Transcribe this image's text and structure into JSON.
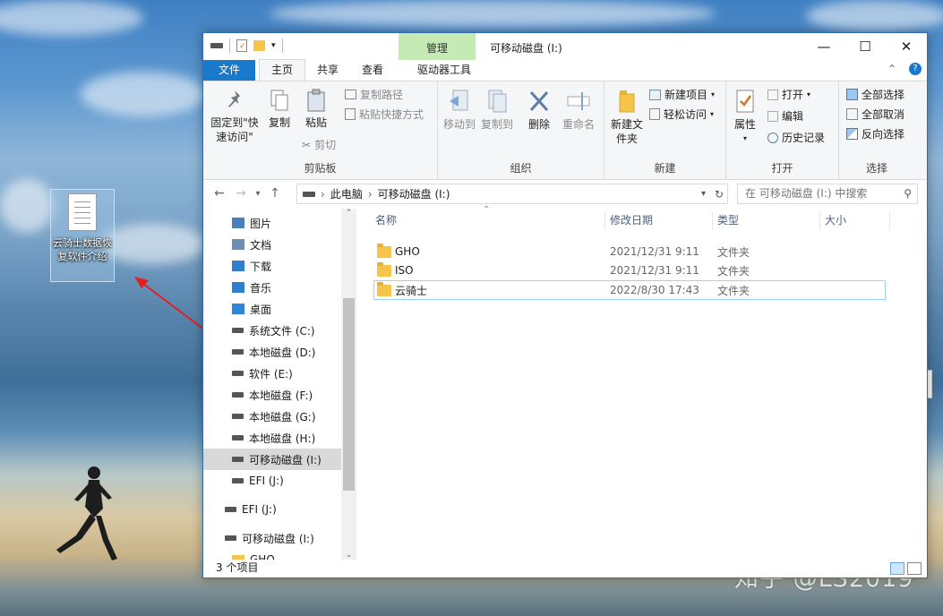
{
  "desktop": {
    "icon_label": "云骑士数据恢复软件介绍",
    "watermark": "知乎 @LS2019"
  },
  "window": {
    "title": "可移动磁盘 (I:)",
    "context_tab": "管理",
    "controls": {
      "minimize": "—",
      "maximize": "☐",
      "close": "✕"
    }
  },
  "tabs": {
    "file": "文件",
    "home": "主页",
    "share": "共享",
    "view": "查看",
    "drive_tools": "驱动器工具"
  },
  "ribbon": {
    "clipboard": {
      "pin": "固定到\"快速访问\"",
      "copy": "复制",
      "paste": "粘贴",
      "copy_path": "复制路径",
      "paste_shortcut": "粘贴快捷方式",
      "cut": "剪切",
      "group": "剪贴板"
    },
    "organize": {
      "move_to": "移动到",
      "copy_to": "复制到",
      "delete": "删除",
      "rename": "重命名",
      "group": "组织"
    },
    "new": {
      "new_folder": "新建文件夹",
      "new_item": "新建项目",
      "easy_access": "轻松访问",
      "group": "新建"
    },
    "open": {
      "properties": "属性",
      "open": "打开",
      "edit": "编辑",
      "history": "历史记录",
      "group": "打开"
    },
    "select": {
      "select_all": "全部选择",
      "select_none": "全部取消",
      "invert": "反向选择",
      "group": "选择"
    }
  },
  "address": {
    "crumbs": [
      "此电脑",
      "可移动磁盘 (I:)"
    ],
    "separator": "›",
    "search_placeholder": "在 可移动磁盘 (I:) 中搜索"
  },
  "nav": {
    "items": [
      {
        "label": "图片",
        "icon": "pictures-icon"
      },
      {
        "label": "文档",
        "icon": "documents-icon"
      },
      {
        "label": "下载",
        "icon": "download-icon"
      },
      {
        "label": "音乐",
        "icon": "music-icon"
      },
      {
        "label": "桌面",
        "icon": "desktop-icon"
      },
      {
        "label": "系统文件 (C:)",
        "icon": "system-drive-icon"
      },
      {
        "label": "本地磁盘 (D:)",
        "icon": "drive-icon"
      },
      {
        "label": "软件 (E:)",
        "icon": "drive-icon"
      },
      {
        "label": "本地磁盘 (F:)",
        "icon": "drive-icon"
      },
      {
        "label": "本地磁盘 (G:)",
        "icon": "drive-icon"
      },
      {
        "label": "本地磁盘 (H:)",
        "icon": "drive-icon"
      },
      {
        "label": "可移动磁盘 (I:)",
        "icon": "usb-drive-icon"
      },
      {
        "label": "EFI (J:)",
        "icon": "usb-drive-icon"
      },
      {
        "label": "EFI (J:)",
        "icon": "usb-drive-icon"
      },
      {
        "label": "可移动磁盘 (I:)",
        "icon": "usb-drive-icon"
      },
      {
        "label": "GHO",
        "icon": "folder-icon"
      }
    ],
    "selected": "可移动磁盘 (I:)"
  },
  "list": {
    "columns": [
      "名称",
      "修改日期",
      "类型",
      "大小"
    ],
    "rows": [
      {
        "name": "GHO",
        "date": "2021/12/31 9:11",
        "type": "文件夹",
        "size": ""
      },
      {
        "name": "ISO",
        "date": "2021/12/31 9:11",
        "type": "文件夹",
        "size": ""
      },
      {
        "name": "云骑士",
        "date": "2022/8/30 17:43",
        "type": "文件夹",
        "size": ""
      }
    ],
    "selected_row": "云骑士"
  },
  "status": {
    "count": "3 个项目"
  },
  "colors": {
    "accent": "#1979ca",
    "context_tab": "#c6eab4",
    "selection": "#99d1ff"
  }
}
